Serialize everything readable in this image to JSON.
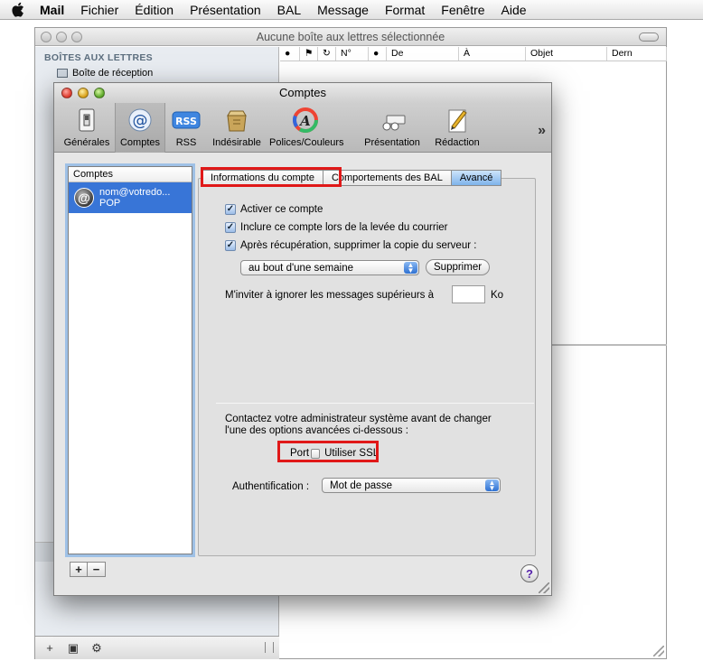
{
  "menubar": {
    "app": "Mail",
    "items": [
      "Fichier",
      "Édition",
      "Présentation",
      "BAL",
      "Message",
      "Format",
      "Fenêtre",
      "Aide"
    ]
  },
  "main_window": {
    "title": "Aucune boîte aux lettres sélectionnée",
    "sidebar": {
      "header": "BOÎTES AUX LETTRES",
      "inbox": "Boîte de réception"
    },
    "columns": [
      "●",
      "⚑",
      "↻",
      "N°",
      "●",
      "De",
      "À",
      "Objet",
      "Dern"
    ]
  },
  "prefs": {
    "title": "Comptes",
    "toolbar": [
      {
        "label": "Générales",
        "icon": "switch-icon"
      },
      {
        "label": "Comptes",
        "icon": "at-icon"
      },
      {
        "label": "RSS",
        "icon": "rss-icon"
      },
      {
        "label": "Indésirable",
        "icon": "junk-icon"
      },
      {
        "label": "Polices/Couleurs",
        "icon": "fonts-colors-icon"
      },
      {
        "label": "Présentation",
        "icon": "viewing-icon"
      },
      {
        "label": "Rédaction",
        "icon": "composing-icon"
      }
    ],
    "more": "»",
    "accounts": {
      "header": "Comptes",
      "items": [
        {
          "name": "nom@votredo...",
          "type": "POP"
        }
      ]
    },
    "tabs": [
      "Informations du compte",
      "Comportements des BAL",
      "Avancé"
    ],
    "options": {
      "enable": "Activer ce compte",
      "include": "Inclure ce compte lors de la levée du courrier",
      "remove_copy": "Après récupération, supprimer la copie du serveur :",
      "remove_when": "au bout d'une semaine",
      "remove_now": "Supprimer",
      "prompt_ignore": "M'inviter à ignorer les messages supérieurs à",
      "size_unit": "Ko",
      "admin_note_1": "Contactez votre administrateur système avant de changer",
      "admin_note_2": "l'une des options avancées ci-dessous :",
      "port_label": "Port",
      "ssl_label": "Utiliser SSL",
      "auth_label": "Authentification :",
      "auth_value": "Mot de passe"
    },
    "add": "+",
    "remove": "−",
    "help": "?"
  },
  "colors": {
    "selection": "#3875d7",
    "highlight_box": "#e01818"
  }
}
